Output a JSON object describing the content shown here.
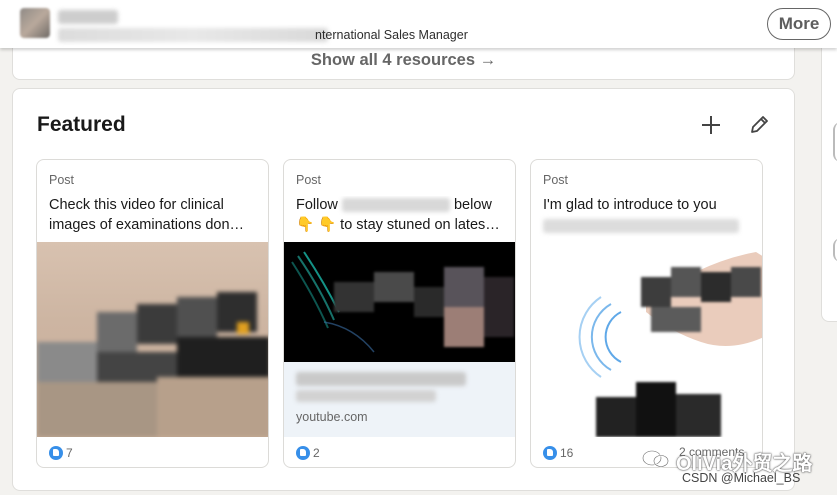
{
  "topbar": {
    "headline": "nternational Sales Manager",
    "more_label": "More"
  },
  "resources": {
    "show_all_label": "Show all 4 resources →"
  },
  "featured": {
    "title": "Featured",
    "add_icon": "plus-icon",
    "edit_icon": "pencil-icon",
    "posts": [
      {
        "type": "Post",
        "line1": "Check this video for clinical",
        "line2": "images of examinations don…",
        "reactions": "7"
      },
      {
        "type": "Post",
        "line1_a": "Follow",
        "line1_b": "below",
        "line2": "👇 👇 to stay stuned on lates…",
        "link_domain": "youtube.com",
        "reactions": "2"
      },
      {
        "type": "Post",
        "line1": "I'm glad to introduce to you",
        "reactions": "16",
        "comments": "2 comments"
      }
    ]
  },
  "watermark": {
    "text": "OliVia外贸之路",
    "csdn": "CSDN @Michael_BS"
  },
  "colors": {
    "page_bg": "#f3f2ef",
    "card_bg": "#ffffff",
    "like_blue": "#378fe9"
  }
}
